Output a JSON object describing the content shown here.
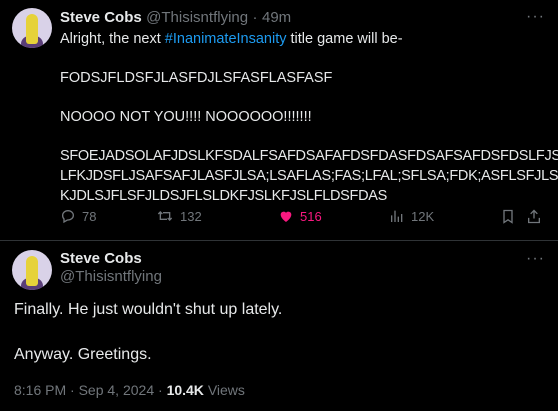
{
  "tweet1": {
    "name": "Steve Cobs",
    "handle": "@Thisisntflying",
    "separator": "·",
    "time": "49m",
    "line1_pre": "Alright, the next ",
    "line1_hashtag": "#InanimateInsanity",
    "line1_post": " title game will be-",
    "line2": "FODSJFLDSFJLASFDJLSFASFLASFASF",
    "line3": "NOOOO NOT YOU!!!! NOOOOOO!!!!!!!",
    "line4a": "SFOEJADSOLAFJDSLKFSDALFSAFDSAFAFDSFDASFDSAFSAFDSFDSLFJSK",
    "line4b": "LFKJDSFLJSAFSAFJLASFJLSA;LSAFLAS;FAS;LFAL;SFLSA;FDK;ASFLSFJLSF",
    "line4c": "KJDLSJFLSFJLDSJFLSLDKFJSLKFJSLFLDSFDAS",
    "stats": {
      "replies": "78",
      "reposts": "132",
      "likes": "516",
      "views": "12K"
    },
    "like_color": "#f91880"
  },
  "tweet2": {
    "name": "Steve Cobs",
    "handle": "@Thisisntflying",
    "line1": "Finally. He just wouldn't shut up lately.",
    "line2": "Anyway. Greetings.",
    "time": "8:16 PM",
    "separator": "·",
    "date": "Sep 4, 2024",
    "separator2": "·",
    "views_count": "10.4K",
    "views_label": "Views"
  },
  "more_label": "···",
  "icons": [
    "reply-icon",
    "repost-icon",
    "like-icon",
    "views-icon",
    "bookmark-icon",
    "share-icon",
    "more-icon"
  ]
}
